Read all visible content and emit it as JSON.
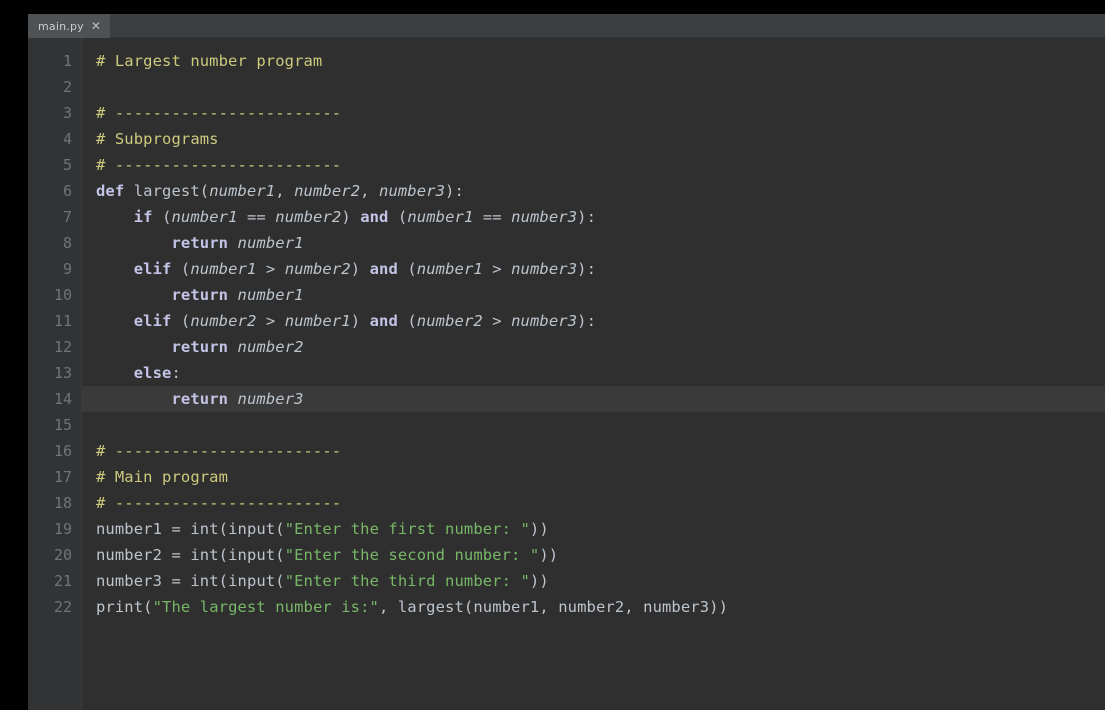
{
  "window": {
    "background": "#2b2b2b",
    "editor_background": "#2f2f2f",
    "gutter_background": "#313335"
  },
  "tabbar": {
    "tabs": [
      {
        "label": "main.py",
        "close_icon": "close-icon",
        "active": true
      }
    ]
  },
  "colors": {
    "comment": "#cdca7e",
    "keyword": "#c3c3e6",
    "string": "#77b767",
    "identifier": "#bcc4cc",
    "line_number": "#717477",
    "current_line_highlight": "#3a3a3a"
  },
  "editor": {
    "language": "Python",
    "current_line": 14,
    "line_numbers": [
      1,
      2,
      3,
      4,
      5,
      6,
      7,
      8,
      9,
      10,
      11,
      12,
      13,
      14,
      15,
      16,
      17,
      18,
      19,
      20,
      21,
      22
    ],
    "lines": [
      {
        "n": 1,
        "text": "# Largest number program"
      },
      {
        "n": 2,
        "text": ""
      },
      {
        "n": 3,
        "text": "# ------------------------"
      },
      {
        "n": 4,
        "text": "# Subprograms"
      },
      {
        "n": 5,
        "text": "# ------------------------"
      },
      {
        "n": 6,
        "text": "def largest(number1, number2, number3):"
      },
      {
        "n": 7,
        "text": "    if (number1 == number2) and (number1 == number3):"
      },
      {
        "n": 8,
        "text": "        return number1"
      },
      {
        "n": 9,
        "text": "    elif (number1 > number2) and (number1 > number3):"
      },
      {
        "n": 10,
        "text": "        return number1"
      },
      {
        "n": 11,
        "text": "    elif (number2 > number1) and (number2 > number3):"
      },
      {
        "n": 12,
        "text": "        return number2"
      },
      {
        "n": 13,
        "text": "    else:"
      },
      {
        "n": 14,
        "text": "        return number3"
      },
      {
        "n": 15,
        "text": ""
      },
      {
        "n": 16,
        "text": "# ------------------------"
      },
      {
        "n": 17,
        "text": "# Main program"
      },
      {
        "n": 18,
        "text": "# ------------------------"
      },
      {
        "n": 19,
        "text": "number1 = int(input(\"Enter the first number: \"))"
      },
      {
        "n": 20,
        "text": "number2 = int(input(\"Enter the second number: \"))"
      },
      {
        "n": 21,
        "text": "number3 = int(input(\"Enter the third number: \"))"
      },
      {
        "n": 22,
        "text": "print(\"The largest number is:\", largest(number1, number2, number3))"
      }
    ]
  }
}
